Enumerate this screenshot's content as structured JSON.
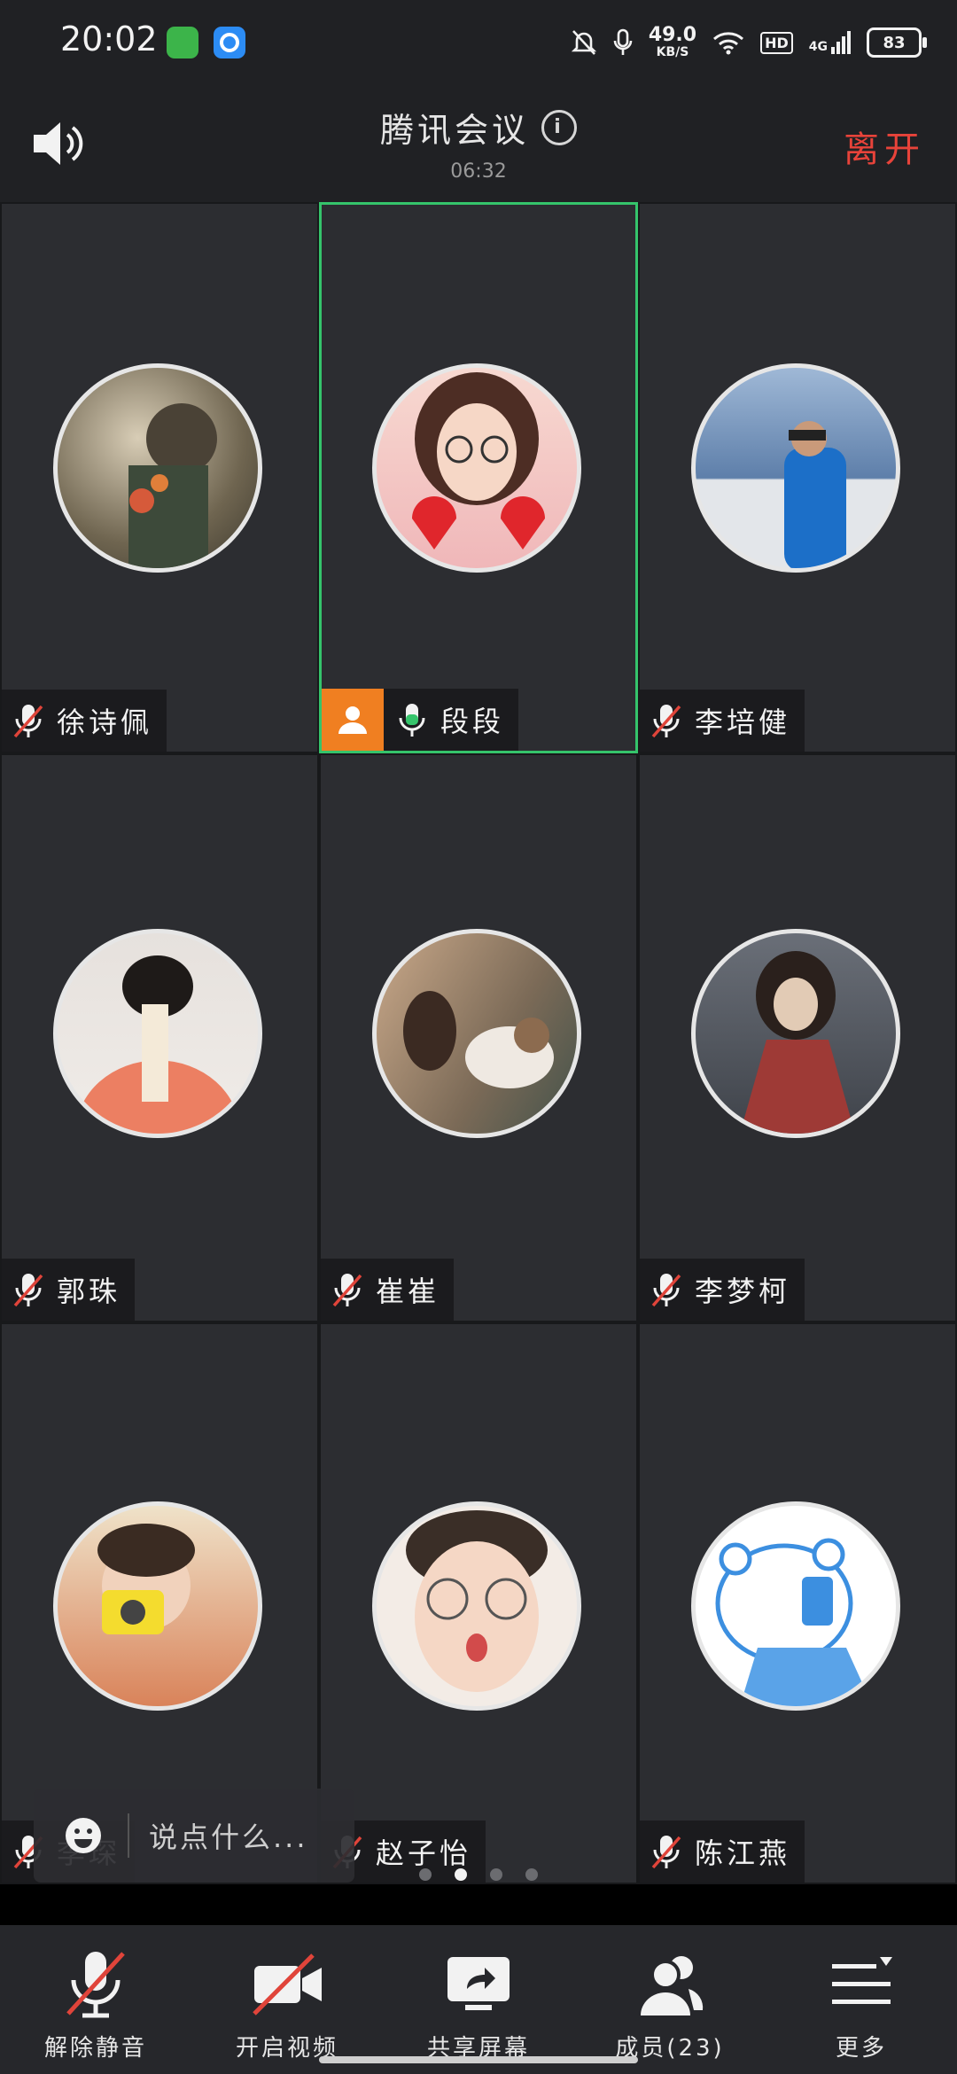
{
  "status_bar": {
    "time": "20:02",
    "net_speed": "49.0",
    "net_unit": "KB/S",
    "hd": "HD",
    "signal": "4G",
    "battery": "83",
    "app_icons": [
      "app-icon-green",
      "app-icon-blue"
    ]
  },
  "header": {
    "title": "腾讯会议",
    "timer": "06:32",
    "leave_label": "离开"
  },
  "participants": [
    {
      "name": "徐诗佩",
      "muted": true,
      "avatar_bg": "#a89a7e"
    },
    {
      "name": "段段",
      "muted": false,
      "host": true,
      "avatar_bg": "#f2b4bd"
    },
    {
      "name": "李培健",
      "muted": true,
      "avatar_bg": "#6c8fb8"
    },
    {
      "name": "郭珠",
      "muted": true,
      "avatar_bg": "#e97e5c"
    },
    {
      "name": "崔崔",
      "muted": true,
      "avatar_bg": "#8a7560"
    },
    {
      "name": "李梦柯",
      "muted": true,
      "avatar_bg": "#9a3a3a"
    },
    {
      "name": "李琛",
      "muted": true,
      "avatar_bg": "#e7c08d"
    },
    {
      "name": "赵子怡",
      "muted": true,
      "avatar_bg": "#d9a98e"
    },
    {
      "name": "陈江燕",
      "muted": true,
      "avatar_bg": "#cfe1f5"
    }
  ],
  "chat": {
    "placeholder": "说点什么..."
  },
  "pager": {
    "pages": 4,
    "current": 2
  },
  "toolbar": {
    "unmute_label": "解除静音",
    "video_label": "开启视频",
    "share_label": "共享屏幕",
    "members_label": "成员(23)",
    "more_label": "更多"
  },
  "colors": {
    "accent_green": "#35c46b",
    "leave_red": "#e8433a",
    "host_orange": "#f07f21",
    "muted_red": "#e0443a"
  }
}
